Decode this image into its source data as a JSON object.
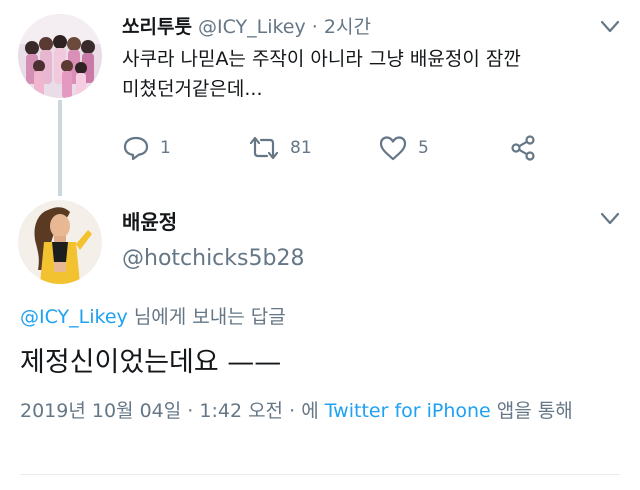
{
  "tweet": {
    "display_name": "쏘리투툿",
    "handle": "@ICY_Likey",
    "separator": "·",
    "time": "2시간",
    "text_line1": "사쿠라 나믿A는 주작이 아니라 그냥 배윤정이 잠깐",
    "text_line2": "미쳤던거같은데...",
    "actions": {
      "reply_count": "1",
      "retweet_count": "81",
      "like_count": "5"
    }
  },
  "reply": {
    "display_name": "배윤정",
    "handle": "@hotchicks5b28",
    "replying_to_handle": "@ICY_Likey",
    "replying_to_suffix": "님에게 보내는 답글",
    "text": "제정신이었는데요 ——",
    "date": "2019년 10월 04일",
    "dot1": "·",
    "time": "1:42 오전",
    "dot2": "·",
    "via_prefix": "에",
    "source": "Twitter for iPhone",
    "via_suffix": "앱을 통해"
  },
  "colors": {
    "text": "#14171a",
    "secondary": "#657786",
    "link": "#1da1f2",
    "thread_line": "#ccd6dd"
  },
  "icons": {
    "reply": "reply-icon",
    "retweet": "retweet-icon",
    "like": "heart-icon",
    "share": "share-icon",
    "more": "chevron-down-icon"
  }
}
